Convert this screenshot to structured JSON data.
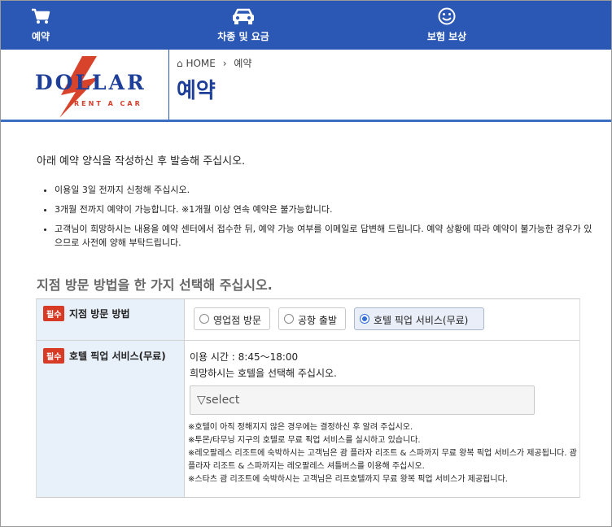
{
  "nav": [
    {
      "label": "예약",
      "icon": "cart-icon"
    },
    {
      "label": "차종 및 요금",
      "icon": "car-icon"
    },
    {
      "label": "보험 보상",
      "icon": "smile-icon"
    }
  ],
  "logo": {
    "main": "DOLLAR",
    "sub": "RENT A CAR"
  },
  "breadcrumb": {
    "home": "HOME",
    "current": "예약"
  },
  "page_title": "예약",
  "intro": "아래 예약 양식을 작성하신 후 발송해 주십시오.",
  "notes": [
    "이용일 3일 전까지 신청해 주십시오.",
    "3개월 전까지 예약이 가능합니다. ※1개월 이상 연속 예약은 불가능합니다.",
    "고객님이 희망하시는 내용을 예약 센터에서 접수한 뒤, 예약 가능 여부를 이메일로 답변해 드립니다. 예약 상황에 따라 예약이 불가능한 경우가 있으므로 사전에 양해 부탁드립니다."
  ],
  "section_title": "지점 방문 방법을 한 가지 선택해 주십시오.",
  "form": {
    "required_badge": "필수",
    "row1_label": "지점 방문 방법",
    "options": [
      "영업점 방문",
      "공항 출발",
      "호텔 픽업 서비스(무료)"
    ],
    "selected_option": "호텔 픽업 서비스(무료)",
    "row2_label": "호텔 픽업 서비스(무료)",
    "hours": "이용 시간 : 8:45～18:00",
    "hotel_prompt": "희망하시는 호텔을 선택해 주십시오.",
    "select_value": "▽select",
    "fine_print": [
      "※호텔이 아직 정해지지 않은 경우에는 결정하신 후 알려 주십시오.",
      "※투몬/타무닝 지구의 호텔로 무료 픽업 서비스를 실시하고 있습니다.",
      "※레오팔레스 리조트에 숙박하시는 고객님은 괌 플라자 리조트 & 스파까지 무료 왕복 픽업 서비스가 제공됩니다. 괌 플라자 리조트 & 스파까지는 레오팔레스 셔틀버스를 이용해 주십시오.",
      "※스타츠 괌 리조트에 숙박하시는 고객님은 리프호텔까지 무료 왕복 픽업 서비스가 제공됩니다."
    ]
  },
  "colors": {
    "nav_bg": "#2b58b4",
    "title_blue": "#1e3f99",
    "badge_red": "#d73b26",
    "label_bg": "#e8f0fa"
  }
}
